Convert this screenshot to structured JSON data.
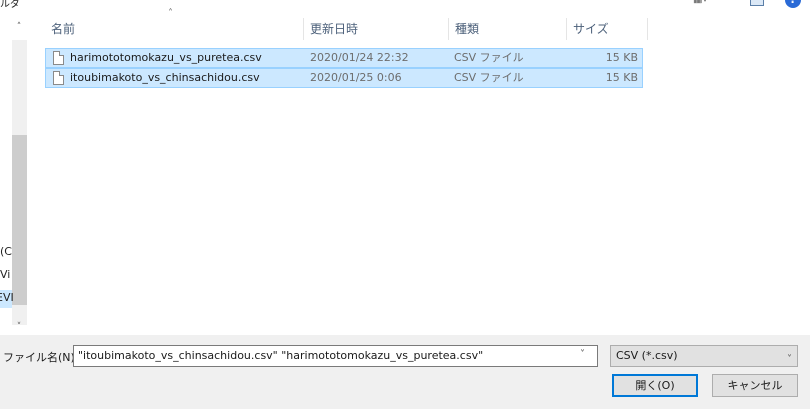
{
  "window": {
    "top_left_text": "ルダ"
  },
  "nav": {
    "items": [
      "(C",
      "Vi",
      "EVI"
    ]
  },
  "columns": {
    "name": "名前",
    "date": "更新日時",
    "type": "種類",
    "size": "サイズ"
  },
  "files": [
    {
      "name": "harimototomokazu_vs_puretea.csv",
      "date": "2020/01/24 22:32",
      "type": "CSV ファイル",
      "size": "15 KB"
    },
    {
      "name": "itoubimakoto_vs_chinsachidou.csv",
      "date": "2020/01/25 0:06",
      "type": "CSV ファイル",
      "size": "15 KB"
    }
  ],
  "bottom": {
    "filename_label": "ファイル名(N):",
    "filename_value": "\"itoubimakoto_vs_chinsachidou.csv\" \"harimototomokazu_vs_puretea.csv\"",
    "filetype_value": "CSV (*.csv)",
    "open_label": "開く(O)",
    "cancel_label": "キャンセル"
  },
  "colors": {
    "selection": "#cce8ff",
    "selection_border": "#99d1ff",
    "accent": "#0078d7"
  },
  "icons": [
    "view-options-icon",
    "preview-pane-icon",
    "help-icon",
    "file-icon",
    "chevron-down-icon",
    "chevron-up-icon"
  ]
}
